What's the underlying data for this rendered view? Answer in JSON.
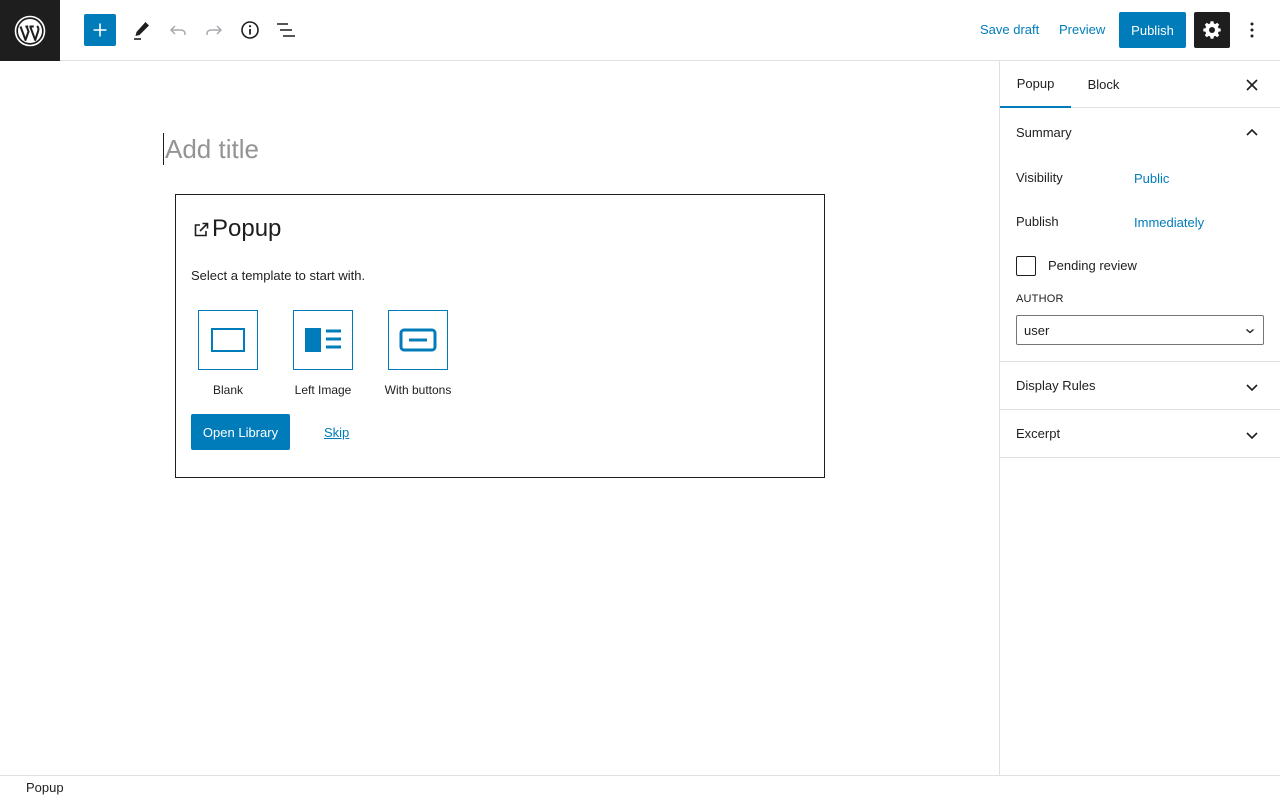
{
  "header": {
    "save_draft": "Save draft",
    "preview": "Preview",
    "publish": "Publish"
  },
  "editor": {
    "title_placeholder": "Add title",
    "block": {
      "name": "Popup",
      "instructions": "Select a template to start with.",
      "templates": [
        {
          "label": "Blank"
        },
        {
          "label": "Left Image"
        },
        {
          "label": "With buttons"
        }
      ],
      "open_library": "Open Library",
      "skip": "Skip"
    }
  },
  "sidebar": {
    "tabs": [
      {
        "label": "Popup",
        "active": true
      },
      {
        "label": "Block",
        "active": false
      }
    ],
    "summary": {
      "title": "Summary",
      "visibility_label": "Visibility",
      "visibility_value": "Public",
      "publish_label": "Publish",
      "publish_value": "Immediately",
      "pending_review": "Pending review",
      "author_label": "AUTHOR",
      "author_value": "user"
    },
    "panels": [
      {
        "title": "Display Rules"
      },
      {
        "title": "Excerpt"
      }
    ]
  },
  "footer": {
    "breadcrumb": "Popup"
  },
  "colors": {
    "accent": "#007cba",
    "dark": "#1e1e1e",
    "border": "#e0e0e0",
    "placeholder": "#949494"
  }
}
